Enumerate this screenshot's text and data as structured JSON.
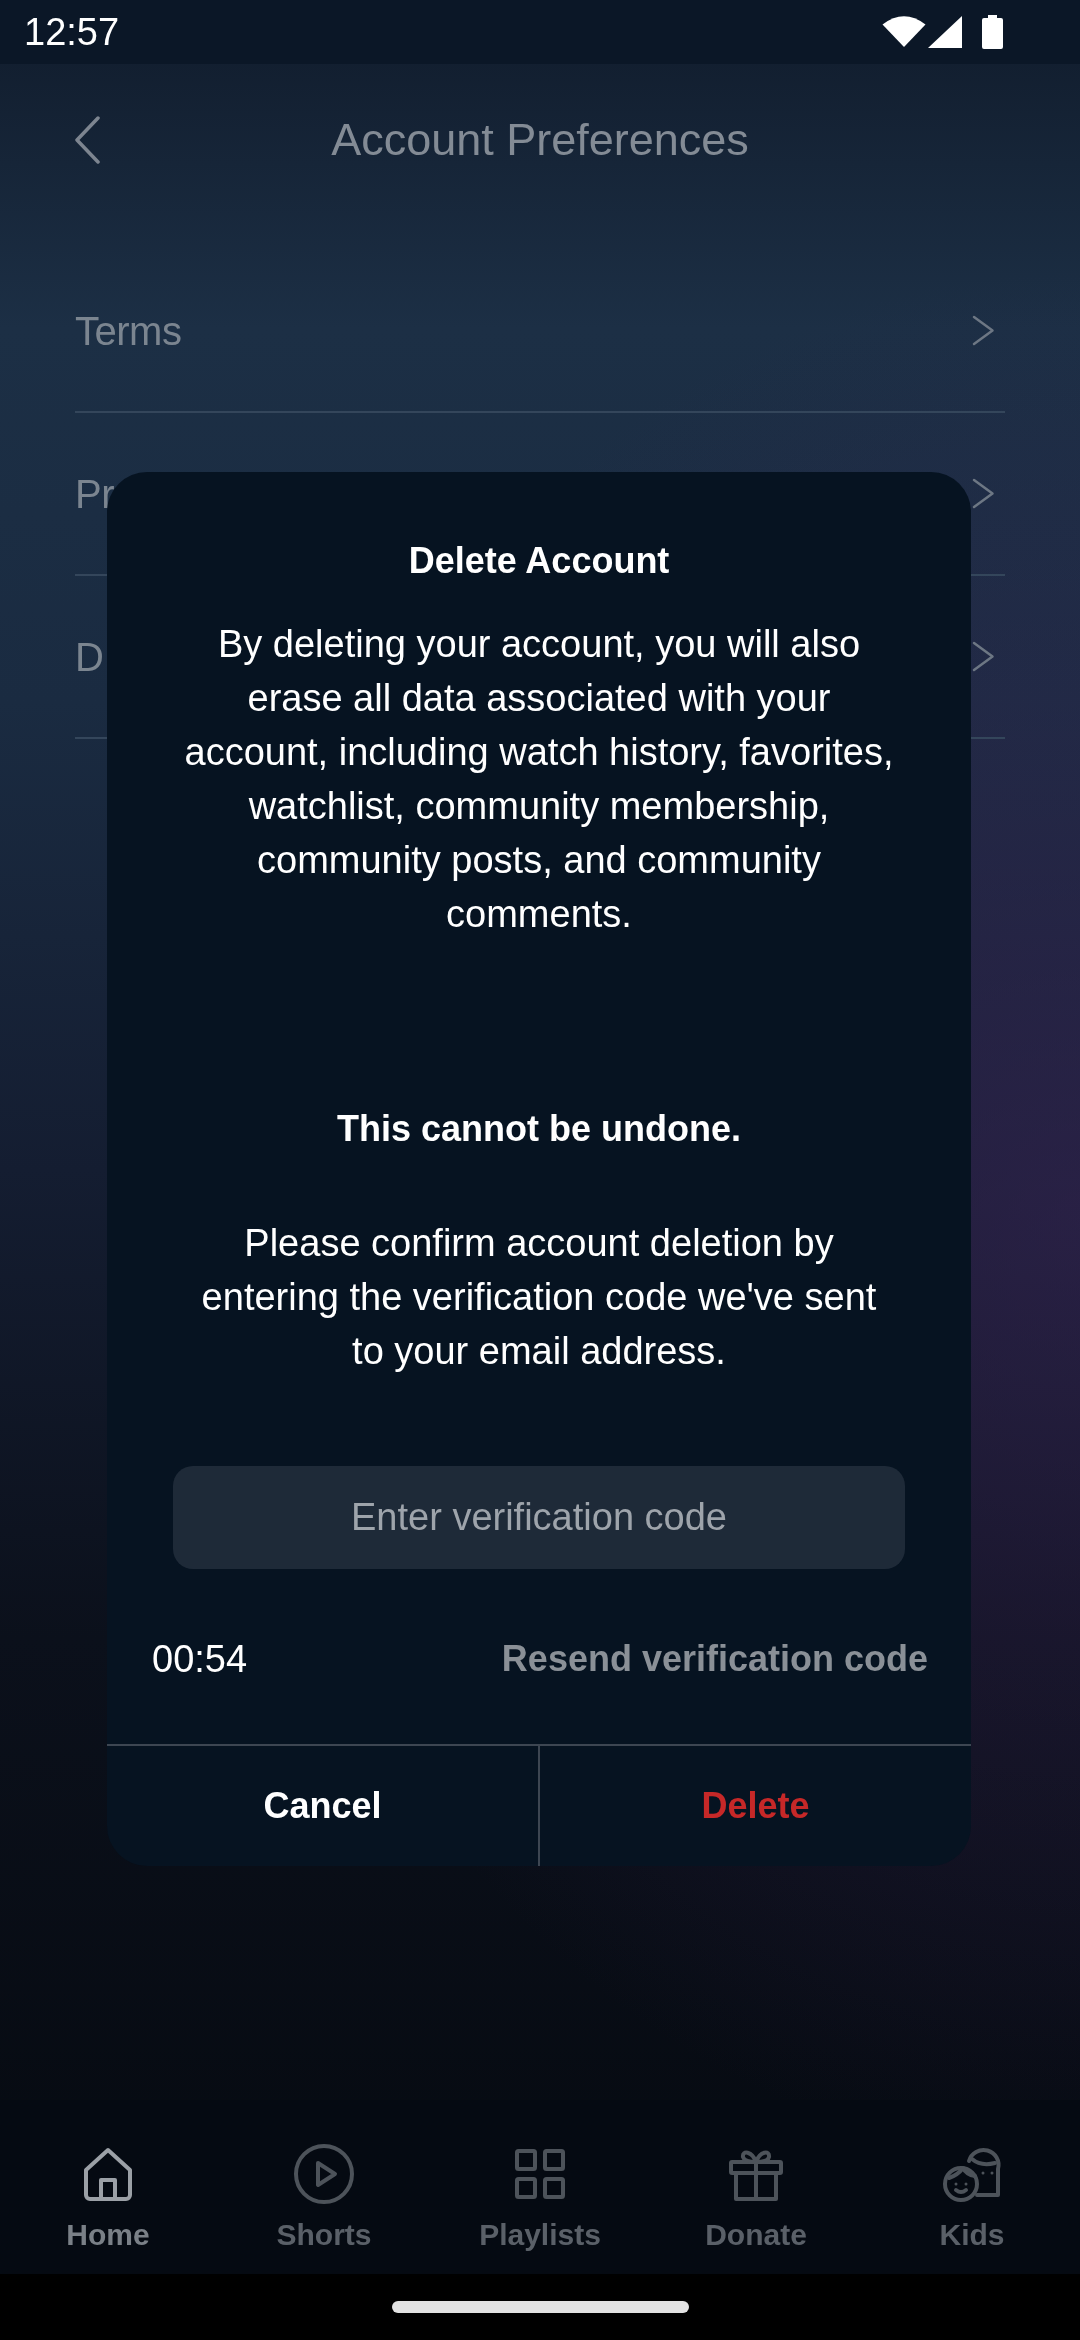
{
  "status_bar": {
    "time": "12:57"
  },
  "header": {
    "title": "Account Preferences"
  },
  "menu": [
    {
      "label": "Terms"
    },
    {
      "label": "Pr"
    },
    {
      "label": "D"
    }
  ],
  "dialog": {
    "title": "Delete Account",
    "message": "By deleting your account, you will also erase all data associated with your account, including watch history, favorites, watchlist, community membership, community posts, and community comments.",
    "warning": "This cannot be undone.",
    "instructions": "Please confirm account deletion by entering the verification code we've sent to your email address.",
    "code_field": {
      "placeholder": "Enter verification code"
    },
    "timer": "00:54",
    "resend": {
      "label": "Resend verification code",
      "disabled": true
    },
    "buttons": [
      {
        "label": "Cancel",
        "kind": "cancel"
      },
      {
        "label": "Delete",
        "kind": "destructive"
      }
    ]
  },
  "nav": [
    {
      "label": "Home",
      "selected": true
    },
    {
      "label": "Shorts",
      "selected": false
    },
    {
      "label": "Playlists",
      "selected": false
    },
    {
      "label": "Donate",
      "selected": false
    },
    {
      "label": "Kids",
      "selected": false
    }
  ]
}
